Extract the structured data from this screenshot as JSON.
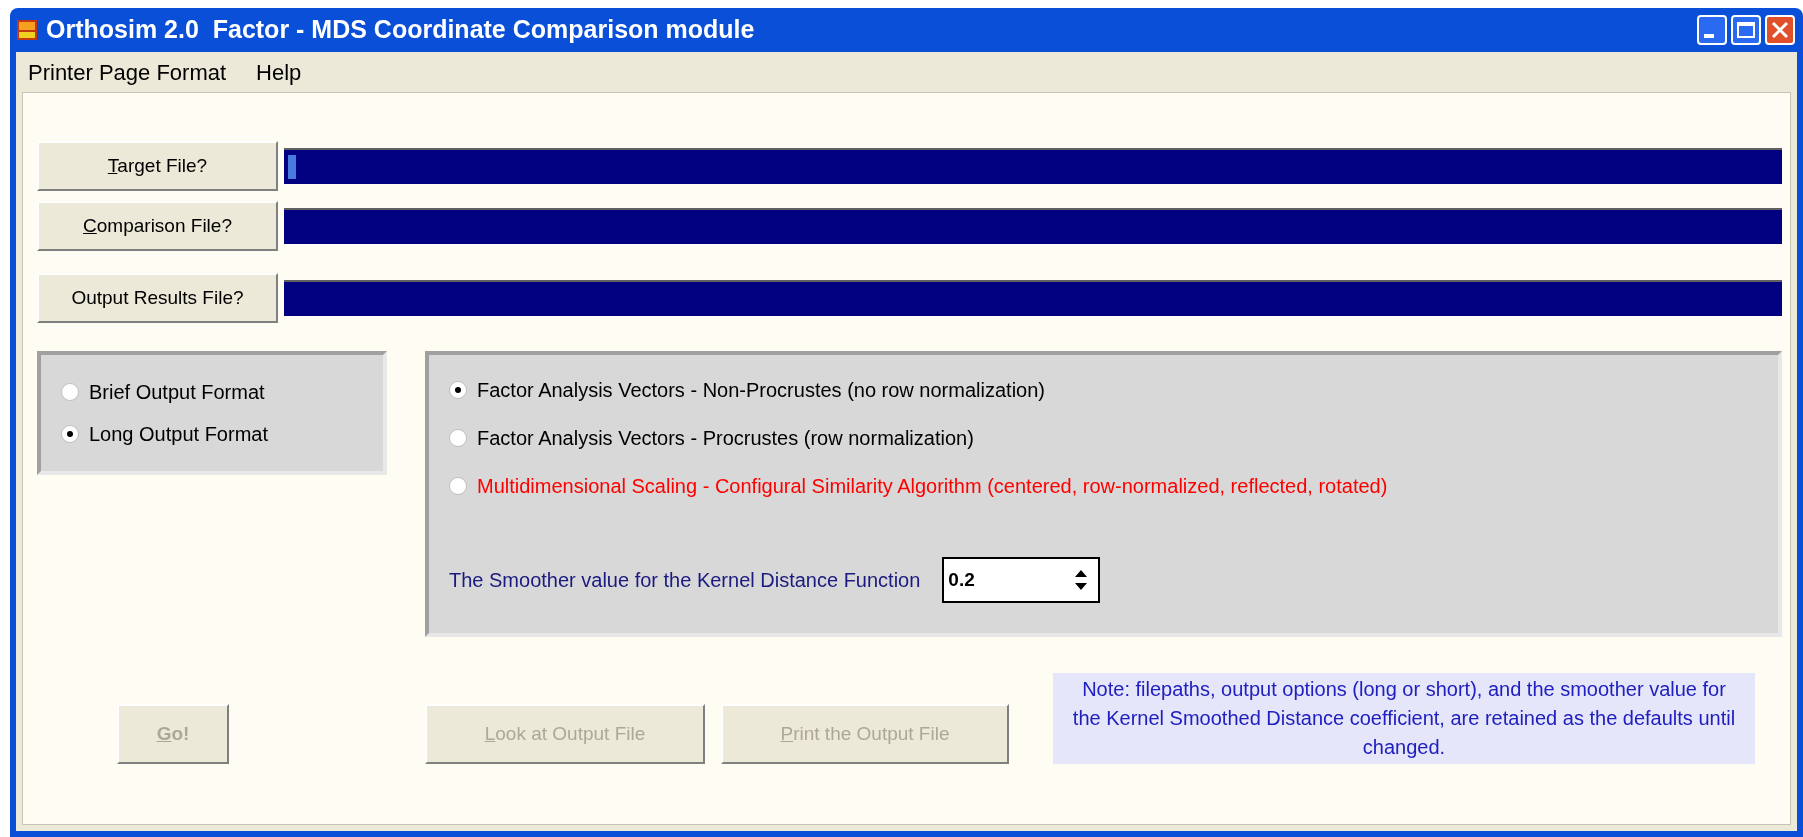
{
  "window": {
    "title": "Orthosim 2.0  Factor - MDS Coordinate Comparison module"
  },
  "menu": [
    "Printer Page Format",
    "Help"
  ],
  "file_rows": [
    {
      "button": "Target File?",
      "access_key": true,
      "value": "",
      "focused": true
    },
    {
      "button": "Comparison File?",
      "access_key": true,
      "value": "",
      "focused": false
    },
    {
      "button": "Output Results File?",
      "access_key": false,
      "value": "",
      "focused": false
    }
  ],
  "output_format": [
    {
      "label": "Brief Output Format",
      "selected": false
    },
    {
      "label": "Long Output Format",
      "selected": true
    }
  ],
  "method": [
    {
      "label": "Factor Analysis Vectors - Non-Procrustes (no row normalization)",
      "selected": true,
      "color": "#000000"
    },
    {
      "label": "Factor Analysis Vectors - Procrustes (row normalization)",
      "selected": false,
      "color": "#000000"
    },
    {
      "label": "Multidimensional Scaling - Configural Similarity Algorithm (centered, row-normalized, reflected, rotated)",
      "selected": false,
      "color": "#ff0000"
    }
  ],
  "smoother": {
    "label": "The Smoother value for the Kernel Distance Function",
    "value": "0.2"
  },
  "actions": [
    {
      "label": "Go!",
      "access_key": true,
      "disabled": true
    },
    {
      "label": "Look at Output File",
      "access_key": true,
      "disabled": true
    },
    {
      "label": "Print the Output File",
      "access_key": true,
      "disabled": true
    }
  ],
  "note": "Note: filepaths, output options (long or short), and the smoother value for the Kernel Smoothed Distance coefficient, are retained as the defaults until changed."
}
